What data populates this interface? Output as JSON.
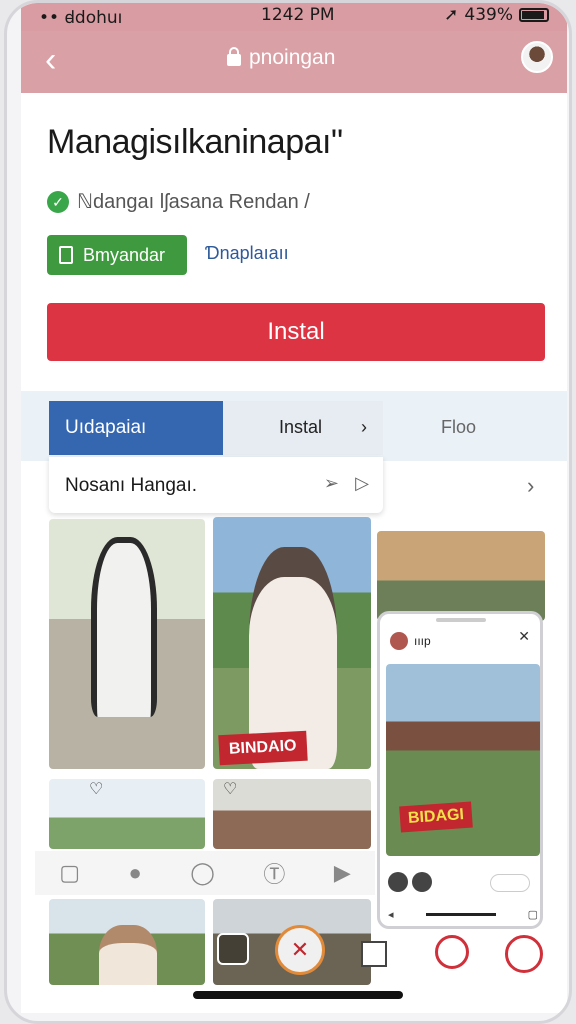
{
  "status_bar": {
    "carrier": "•• ꟈdohuı ",
    "time": "1242 PM",
    "battery": "439%"
  },
  "top_bar": {
    "url": "pnoingan"
  },
  "app": {
    "title": "Managisılkaninapaı\"",
    "verified_text": "ℕdangaı lʃasana Rendan /",
    "secondary_button": "Bmyandar",
    "secondary_link": "Ɗnaplaıaıı",
    "install_label": "Instal"
  },
  "tabs": [
    {
      "label": "Uıdapaiaı"
    },
    {
      "label": "Instal"
    },
    {
      "label": "Floo"
    }
  ],
  "message": {
    "text": "Nosanı Hangaı."
  },
  "photos": {
    "banner_text": "BINDAIO"
  },
  "popup": {
    "title": "ıııp",
    "banner_text": "BIDAGI"
  },
  "colors": {
    "header": "#d9a0a6",
    "install": "#dd3444",
    "accent_blue": "#3566b0",
    "green": "#3f9a3f"
  }
}
